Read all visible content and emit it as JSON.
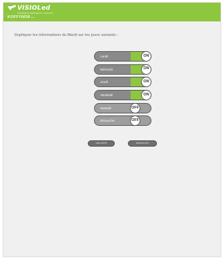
{
  "header": {
    "logo_text": "VISIOLed",
    "logo_tagline": "Intelligent lighting for humans",
    "brand_name": "KOFFYNOR",
    "brand_suffix": ".com"
  },
  "instruction": "Dupliquer les informations du Mardi sur les jours suivants :",
  "days": [
    {
      "label": "Lundi",
      "state_label": "ON",
      "on": true
    },
    {
      "label": "Mercredi",
      "state_label": "ON",
      "on": true
    },
    {
      "label": "Jeudi",
      "state_label": "ON",
      "on": true
    },
    {
      "label": "Vendredi",
      "state_label": "ON",
      "on": true
    },
    {
      "label": "Samedi",
      "state_label": "OFF",
      "on": false
    },
    {
      "label": "Dimanche",
      "state_label": "OFF",
      "on": false
    }
  ],
  "actions": {
    "validate_label": "VALIDER",
    "cancel_label": "ANNULER"
  },
  "colors": {
    "header": "#8dc63f",
    "toggle_on": "#8dc63f",
    "toggle_track": "#8a8a8a",
    "button": "#6f6f6f"
  }
}
